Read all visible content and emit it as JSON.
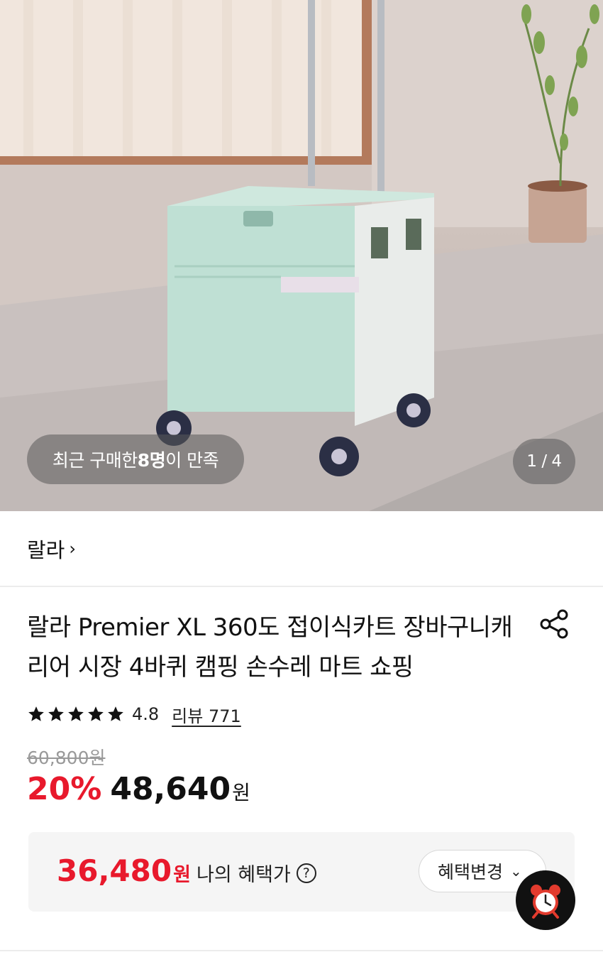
{
  "hero": {
    "buyers_prefix": "최근 구매한 ",
    "buyers_count": "8명",
    "buyers_suffix": "이 만족",
    "image_counter": "1 / 4"
  },
  "brand": {
    "name": "랄라",
    "chevron": "›"
  },
  "product": {
    "title": "랄라 Premier XL 360도 접이식카트 장바구니캐리어 시장 4바퀴 캠핑 손수레 마트 쇼핑",
    "rating": 4.8,
    "rating_text": "4.8",
    "review_label": "리뷰 771"
  },
  "price": {
    "original": "60,800원",
    "discount": "20%",
    "sale_price": "48,640",
    "currency": "원"
  },
  "benefit": {
    "price": "36,480",
    "currency": "원",
    "label": "나의 혜택가",
    "help": "?",
    "change_button": "혜택변경",
    "change_chevron": "⌄"
  },
  "colors": {
    "accent_red": "#e8192c",
    "text": "#111111",
    "muted": "#999999",
    "box_bg": "#f5f5f5"
  },
  "icons": {
    "share": "share-icon",
    "star": "star-icon",
    "alarm": "alarm-clock-icon",
    "help": "question-circle-icon"
  }
}
